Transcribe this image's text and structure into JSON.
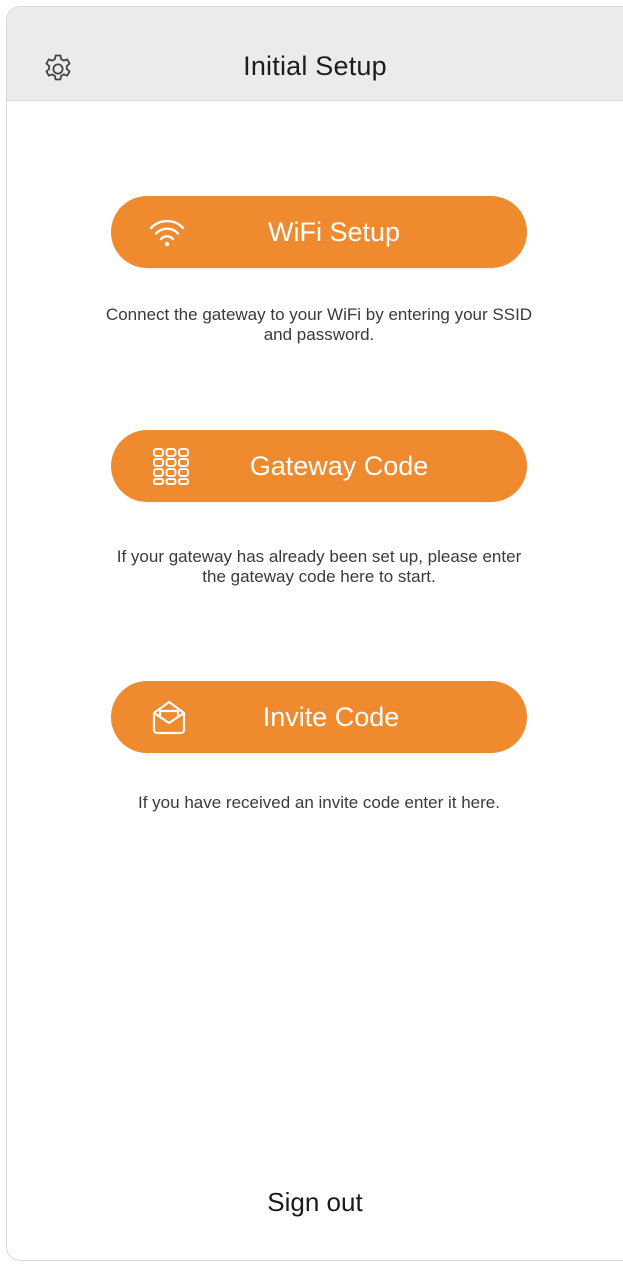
{
  "header": {
    "title": "Initial Setup",
    "settings_icon": "gear-icon"
  },
  "actions": [
    {
      "id": "wifi",
      "icon": "wifi-icon",
      "label": "WiFi Setup",
      "description": "Connect the gateway to your WiFi by entering your SSID and password."
    },
    {
      "id": "gateway",
      "icon": "keypad-icon",
      "label": "Gateway Code",
      "description": "If your gateway has already been set up, please enter the gateway code here to start."
    },
    {
      "id": "invite",
      "icon": "envelope-icon",
      "label": "Invite Code",
      "description": "If you have received an invite code enter it here."
    }
  ],
  "footer": {
    "signout_label": "Sign out"
  },
  "colors": {
    "accent": "#ef8a2e",
    "header_bg": "#ebebeb",
    "button_text": "#ffffff"
  }
}
